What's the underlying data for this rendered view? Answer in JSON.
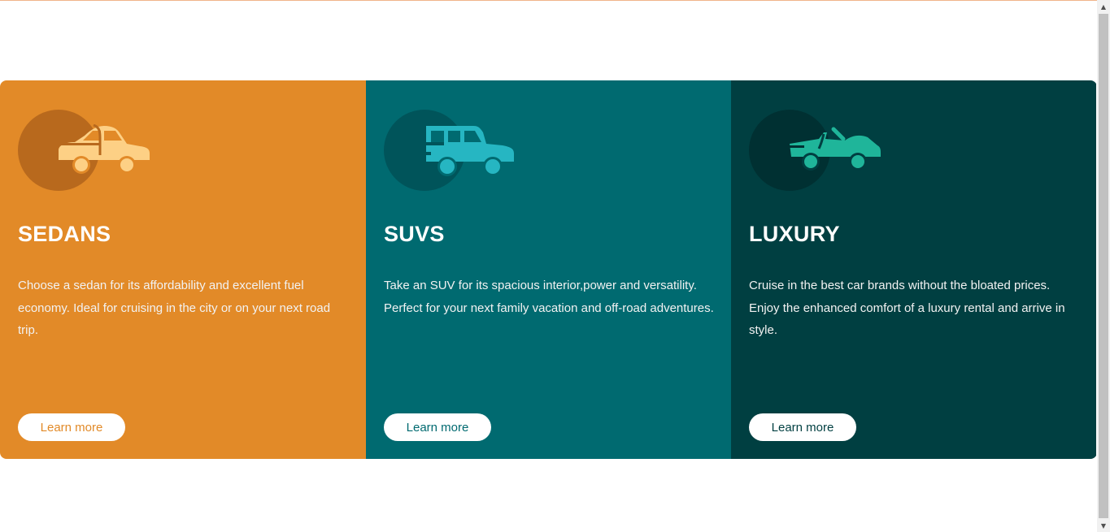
{
  "colors": {
    "sedans_bg": "#e28a28",
    "sedans_circle": "#b8691d",
    "sedans_icon": "#fdd085",
    "suvs_bg": "#006a70",
    "suvs_circle": "#00545a",
    "suvs_icon": "#26b6c2",
    "luxury_bg": "#003f41",
    "luxury_circle": "#003032",
    "luxury_icon": "#1fb59a"
  },
  "cards": [
    {
      "title": "SEDANS",
      "icon": "sedan-car-icon",
      "description": "Choose a sedan for its affordability and excellent fuel economy. Ideal for cruising in the city or on your next road trip.",
      "button_label": "Learn more"
    },
    {
      "title": "SUVS",
      "icon": "suv-car-icon",
      "description": "Take an SUV for its spacious interior,power and versatility. Perfect for your next family vacation and off-road adventures.",
      "button_label": "Learn more"
    },
    {
      "title": "LUXURY",
      "icon": "convertible-car-icon",
      "description": "Cruise in the best car brands without the bloated prices. Enjoy the enhanced comfort of a luxury rental and arrive in style.",
      "button_label": "Learn more"
    }
  ]
}
